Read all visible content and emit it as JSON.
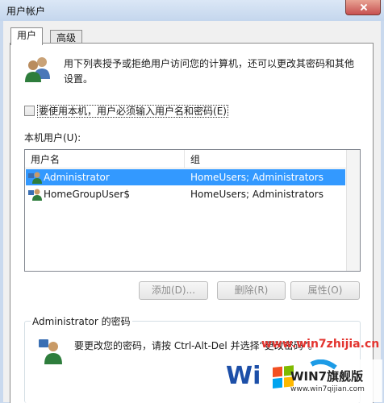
{
  "window": {
    "title": "用户帐户"
  },
  "tabs": [
    {
      "label": "用户",
      "active": true
    },
    {
      "label": "高级",
      "active": false
    }
  ],
  "intro": {
    "text": "用下列表授予或拒绝用户访问您的计算机，还可以更改其密码和其他设置。"
  },
  "checkbox": {
    "label": "要使用本机，用户必须输入用户名和密码",
    "accel": "(E)",
    "checked": false
  },
  "users_label": "本机用户(U):",
  "list": {
    "columns": [
      "用户名",
      "组"
    ],
    "rows": [
      {
        "name": "Administrator",
        "group": "HomeUsers; Administrators",
        "selected": true
      },
      {
        "name": "HomeGroupUser$",
        "group": "HomeUsers; Administrators",
        "selected": false
      }
    ]
  },
  "buttons": {
    "add": "添加(D)...",
    "remove": "删除(R)",
    "properties": "属性(O)"
  },
  "password_group": {
    "title": "Administrator 的密码",
    "text": "要更改您的密码，请按 Ctrl-Alt-Del 并选择“更改密码”。"
  },
  "watermark": {
    "url": "www.win7zhijia.cn",
    "logo_text": "Wi",
    "brand": "WIN7旗舰版",
    "site": "www.win7qijian.com"
  },
  "colors": {
    "selection": "#3399ff",
    "watermark_red": "#e3342f"
  }
}
